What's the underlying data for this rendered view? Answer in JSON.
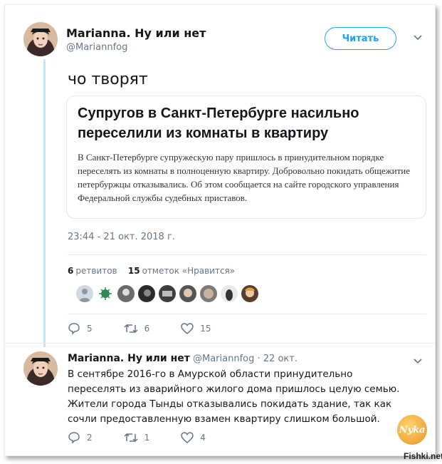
{
  "tweet": {
    "author_name": "Marianna. Ну или нет",
    "author_handle": "@Mariannfog",
    "follow_label": "Читать",
    "text": "чо творят",
    "card": {
      "title": "Супругов в Санкт-Петербурге насильно переселили из комнаты в квартиру",
      "description": "В Санкт-Петербурге супружескую пару пришлось в принудительном порядке переселять из комнаты в полноценную квартиру. Добровольно покидать общежитие петербуржцы отказывались. Об этом сообщается на сайте городского управления Федеральной службы судебных приставов."
    },
    "timestamp": "23:44 - 21 окт. 2018 г.",
    "retweets_count": "6",
    "retweets_label": "ретвитов",
    "likes_count": "15",
    "likes_label": "отметок «Нравится»",
    "actions": {
      "reply": "5",
      "retweet": "6",
      "like": "15"
    }
  },
  "reply": {
    "author_name": "Marianna. Ну или нет",
    "author_handle": "@Mariannfog",
    "date": "· 22 окт.",
    "text": "В сентябре 2016-го в Амурской области принудительно переселять из аварийного жилого дома пришлось целую семью. Жители города Тынды отказывались покидать здание, так как сочли предоставленную взамен квартиру слишком большой.",
    "actions": {
      "reply": "2",
      "retweet": "1",
      "like": "4"
    }
  },
  "watermark": {
    "badge": "Nyka",
    "site": "Fishki.net"
  },
  "icons": [
    "chevron-down-icon",
    "reply-icon",
    "retweet-icon",
    "like-icon"
  ],
  "colors": {
    "accent": "#1da1f2",
    "muted": "#657786",
    "thread": "#c4e4f7"
  }
}
